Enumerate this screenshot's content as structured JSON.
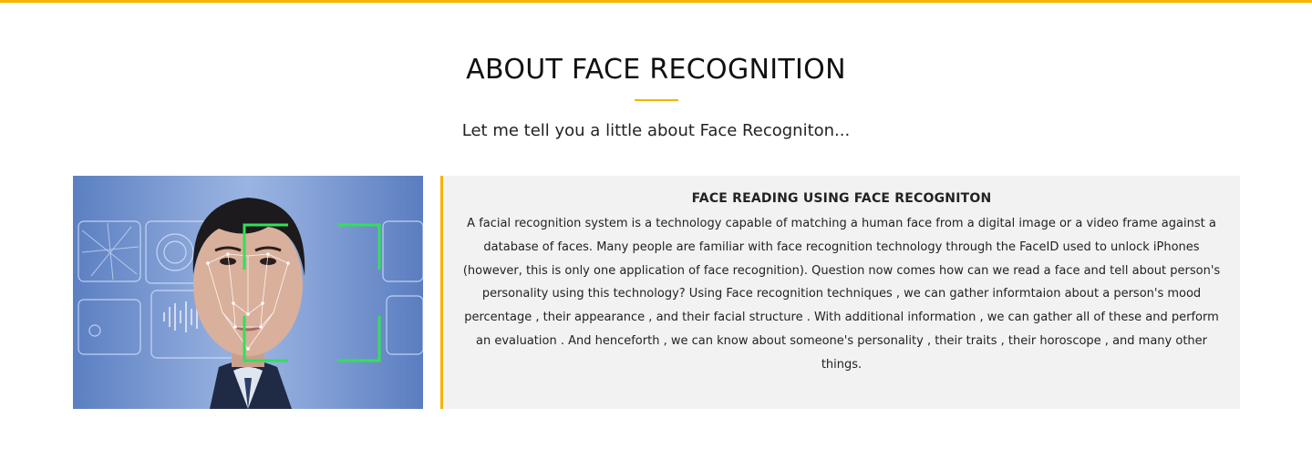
{
  "section": {
    "title": "ABOUT FACE RECOGNITION",
    "subtitle": "Let me tell you a little about Face Recogniton..."
  },
  "card": {
    "image_label": "face-recognition-illustration",
    "heading": "FACE READING USING FACE RECOGNITON",
    "body": "A facial recognition system is a technology capable of matching a human face from a digital image or a video frame against a database of faces. Many people are familiar with face recognition technology through the FaceID used to unlock iPhones (however, this is only one application of face recognition). Question now comes how can we read a face and tell about person's personality using this technology? Using Face recognition techniques , we can gather informtaion about a person's mood percentage , their appearance , and their facial structure . With additional information , we can gather all of these and perform an evaluation . And henceforth , we can know about someone's personality , their traits , their horoscope , and many other things."
  },
  "colors": {
    "accent": "#f4b400",
    "panel_background": "#f2f2f2",
    "text": "#222222"
  }
}
